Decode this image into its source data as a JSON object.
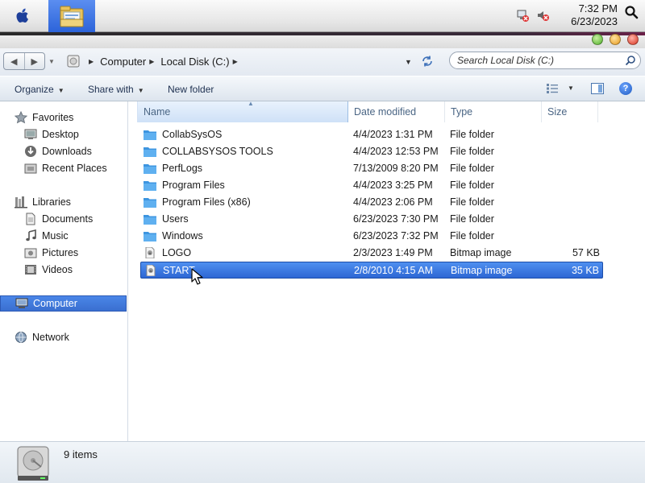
{
  "menubar": {
    "apple_icon": "apple-icon",
    "app_icon": "file-explorer-icon",
    "clock_time": "7:32 PM",
    "clock_date": "6/23/2023"
  },
  "address": {
    "breadcrumb": [
      "Computer",
      "Local Disk (C:)"
    ],
    "search_placeholder": "Search Local Disk (C:)"
  },
  "commandbar": {
    "organize": "Organize",
    "share_with": "Share with",
    "new_folder": "New folder"
  },
  "navpane": {
    "favorites": {
      "label": "Favorites",
      "items": [
        "Desktop",
        "Downloads",
        "Recent Places"
      ]
    },
    "libraries": {
      "label": "Libraries",
      "items": [
        "Documents",
        "Music",
        "Pictures",
        "Videos"
      ]
    },
    "computer": "Computer",
    "network": "Network"
  },
  "columns": {
    "name": "Name",
    "date": "Date modified",
    "type": "Type",
    "size": "Size"
  },
  "files": [
    {
      "name": "CollabSysOS",
      "date": "4/4/2023 1:31 PM",
      "type": "File folder",
      "size": "",
      "kind": "folder"
    },
    {
      "name": "COLLABSYSOS TOOLS",
      "date": "4/4/2023 12:53 PM",
      "type": "File folder",
      "size": "",
      "kind": "folder"
    },
    {
      "name": "PerfLogs",
      "date": "7/13/2009 8:20 PM",
      "type": "File folder",
      "size": "",
      "kind": "folder"
    },
    {
      "name": "Program Files",
      "date": "4/4/2023 3:25 PM",
      "type": "File folder",
      "size": "",
      "kind": "folder"
    },
    {
      "name": "Program Files (x86)",
      "date": "4/4/2023 2:06 PM",
      "type": "File folder",
      "size": "",
      "kind": "folder"
    },
    {
      "name": "Users",
      "date": "6/23/2023 7:30 PM",
      "type": "File folder",
      "size": "",
      "kind": "folder"
    },
    {
      "name": "Windows",
      "date": "6/23/2023 7:32 PM",
      "type": "File folder",
      "size": "",
      "kind": "folder"
    },
    {
      "name": "LOGO",
      "date": "2/3/2023 1:49 PM",
      "type": "Bitmap image",
      "size": "57 KB",
      "kind": "bitmap"
    },
    {
      "name": "START",
      "date": "2/8/2010 4:15 AM",
      "type": "Bitmap image",
      "size": "35 KB",
      "kind": "bitmap",
      "selected": true
    }
  ],
  "status": {
    "items_count": "9 items"
  },
  "colors": {
    "accent": "#3a6fd0",
    "folder": "#4aa3e8"
  }
}
